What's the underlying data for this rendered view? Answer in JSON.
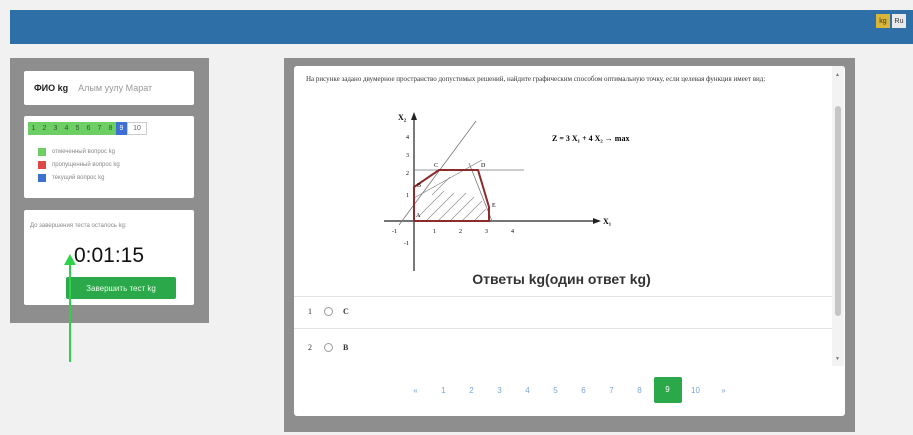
{
  "header": {
    "lang_ky": "kg",
    "lang_ru": "Ru"
  },
  "sidebar": {
    "fio_label": "ФИО kg",
    "fio_value": "Алым уулу Марат",
    "question_numbers": [
      "1",
      "2",
      "3",
      "4",
      "5",
      "6",
      "7",
      "8",
      "9",
      "10"
    ],
    "current_question": "9",
    "legend": [
      {
        "label": "отмеченный вопрос kg",
        "color": "#6dcf63"
      },
      {
        "label": "пропущенный вопрос kg",
        "color": "#e04848"
      },
      {
        "label": "текущий вопрос kg",
        "color": "#3f6fd0"
      }
    ],
    "timer_label": "До завершения теста осталось kg:",
    "timer_value": "0:01:15",
    "finish_button": "Завершить тест kg"
  },
  "question": {
    "text": "На рисунке задано двумерное пространство допустимых решений, найдите графическим способом оптимальную точку, если целевая функция имеет вид:",
    "figure": {
      "objective": "Z = 3 X₁ + 4 X₂ → max",
      "y_axis_label": "X₂",
      "x_axis_label": "X₁",
      "x_ticks": [
        "-1",
        "1",
        "2",
        "3",
        "4"
      ],
      "y_ticks": [
        "-1",
        "1",
        "2",
        "3",
        "4"
      ],
      "point_labels": [
        "A",
        "B",
        "C",
        "D",
        "E"
      ]
    }
  },
  "answers": {
    "title": "Ответы kg(один ответ kg)",
    "items": [
      {
        "num": "1",
        "text": "C"
      },
      {
        "num": "2",
        "text": "B"
      }
    ]
  },
  "pagination": {
    "prev": "«",
    "pages": [
      "1",
      "2",
      "3",
      "4",
      "5",
      "6",
      "7",
      "8",
      "9",
      "10"
    ],
    "active": "9",
    "next": "»"
  }
}
